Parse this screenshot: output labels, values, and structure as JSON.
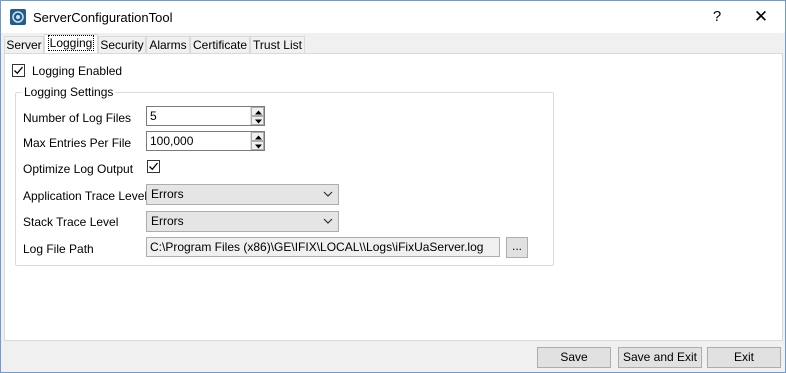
{
  "window": {
    "title": "ServerConfigurationTool",
    "help_glyph": "?",
    "close_glyph": "✕"
  },
  "tabs": [
    {
      "label": "Server"
    },
    {
      "label": "Logging",
      "active": true
    },
    {
      "label": "Security"
    },
    {
      "label": "Alarms"
    },
    {
      "label": "Certificate"
    },
    {
      "label": "Trust List"
    }
  ],
  "logging": {
    "enabled_label": "Logging Enabled",
    "enabled_checked": true,
    "group_title": "Logging Settings",
    "num_files_label": "Number of Log Files",
    "num_files_value": "5",
    "max_entries_label": "Max Entries Per File",
    "max_entries_value": "100,000",
    "optimize_label": "Optimize Log Output",
    "optimize_checked": true,
    "app_trace_label": "Application Trace Level",
    "app_trace_value": "Errors",
    "stack_trace_label": "Stack Trace Level",
    "stack_trace_value": "Errors",
    "path_label": "Log File Path",
    "path_value": "C:\\Program Files (x86)\\GE\\IFIX\\LOCAL\\\\Logs\\iFixUaServer.log",
    "browse_label": "..."
  },
  "footer": {
    "save_label": "Save",
    "save_exit_label": "Save and Exit",
    "exit_label": "Exit"
  },
  "icons": {
    "app": "server-gear-icon",
    "spin_up": "spin-up-icon",
    "spin_down": "spin-down-icon",
    "dropdown": "chevron-down-icon",
    "check": "checkmark-icon"
  }
}
